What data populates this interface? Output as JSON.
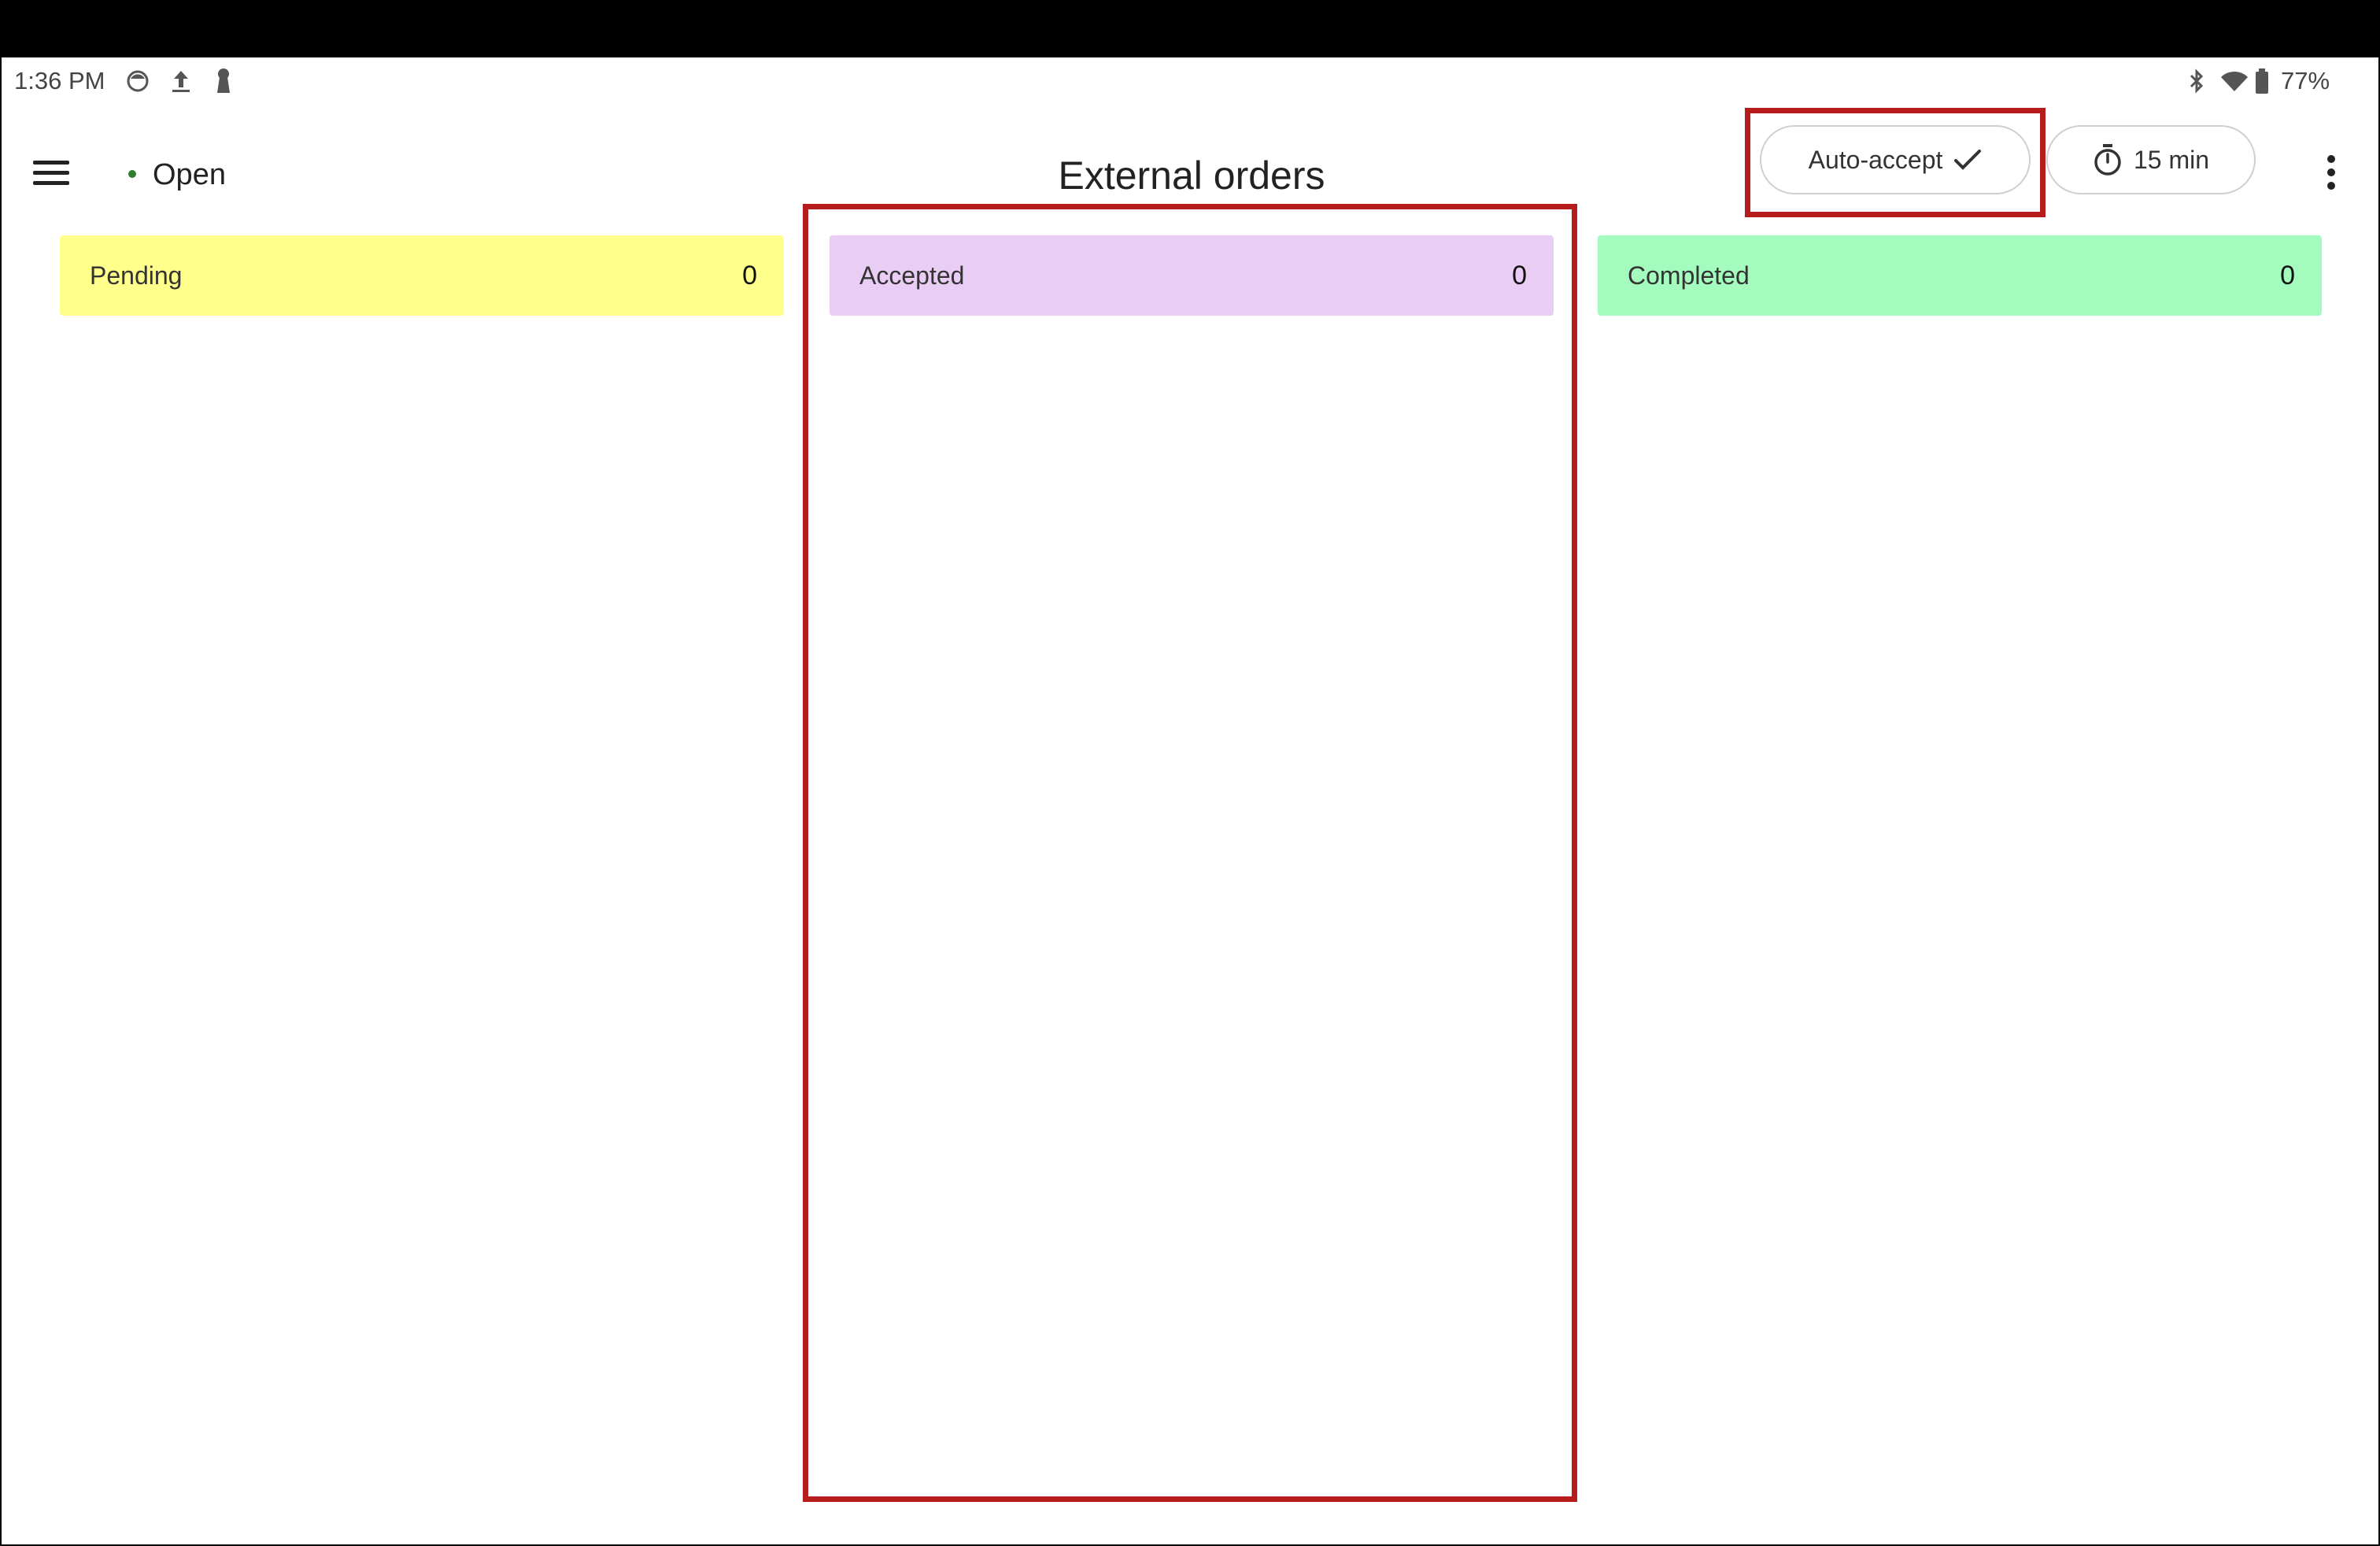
{
  "status_bar": {
    "time": "1:36 PM",
    "left_icons": [
      "data-saver-icon",
      "upload-icon",
      "keyhole-icon"
    ],
    "right_icons": [
      "bluetooth-icon",
      "wifi-icon",
      "battery-icon"
    ],
    "battery": "77%"
  },
  "app_bar": {
    "store_status": "Open",
    "title": "External orders",
    "auto_accept_label": "Auto-accept",
    "timer_label": "15 min"
  },
  "columns": [
    {
      "label": "Pending",
      "count": "0",
      "color": "#ffff8c"
    },
    {
      "label": "Accepted",
      "count": "0",
      "color": "#eacdf4"
    },
    {
      "label": "Completed",
      "count": "0",
      "color": "#a3fbbe"
    }
  ],
  "colors": {
    "highlight": "#b71c1c",
    "open_dot": "#2e7d32"
  }
}
